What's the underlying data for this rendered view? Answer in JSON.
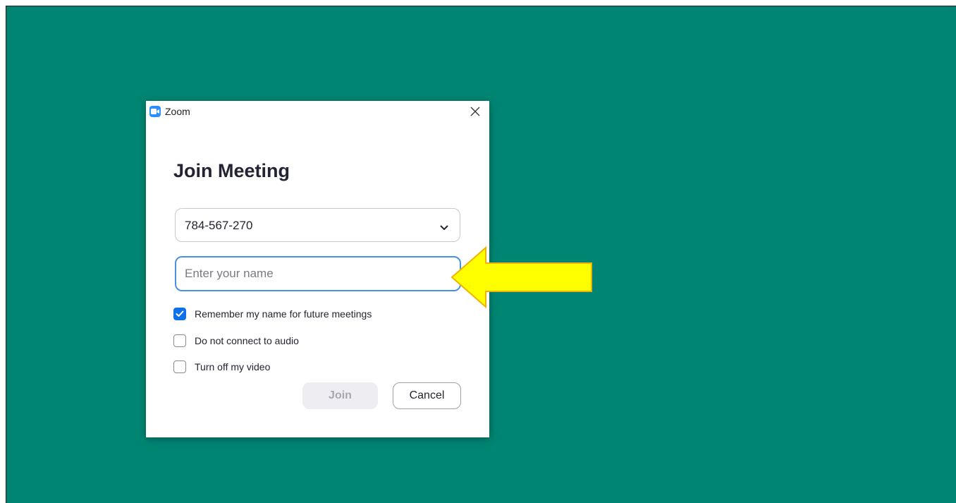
{
  "window": {
    "title": "Zoom",
    "app_icon": "zoom-camera-icon",
    "close_icon": "close-icon"
  },
  "dialog": {
    "heading": "Join Meeting",
    "meeting_id": {
      "value": "784-567-270",
      "icon": "chevron-down-icon"
    },
    "name_input": {
      "value": "",
      "placeholder": "Enter your name"
    },
    "options": [
      {
        "label": "Remember my name for future meetings",
        "checked": true
      },
      {
        "label": "Do not connect to audio",
        "checked": false
      },
      {
        "label": "Turn off my video",
        "checked": false
      }
    ],
    "buttons": {
      "join": "Join",
      "join_enabled": false,
      "cancel": "Cancel"
    }
  },
  "annotation": {
    "type": "arrow-left",
    "color": "#ffff00",
    "border_color": "#f0b400"
  },
  "colors": {
    "background": "#008573",
    "accent": "#0e71eb",
    "focus_border": "#4a90e2"
  }
}
